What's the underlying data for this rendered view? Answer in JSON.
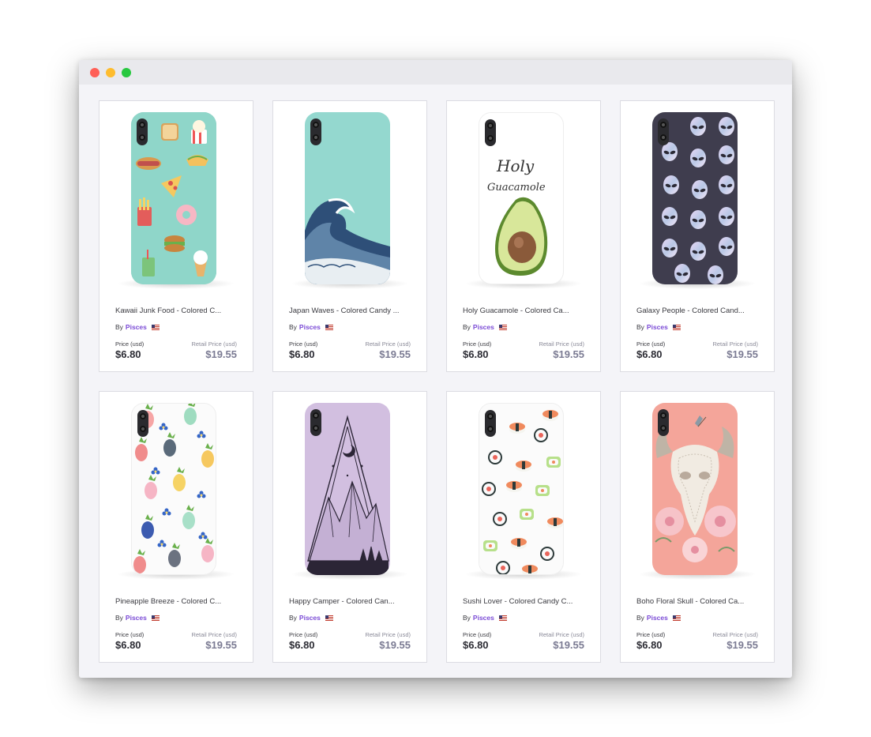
{
  "window": {
    "controls": [
      "close",
      "minimize",
      "maximize"
    ]
  },
  "labels": {
    "by": "By",
    "price": "Price (usd)",
    "retail": "Retail Price (usd)"
  },
  "products": [
    {
      "title": "Kawaii Junk Food - Colored C...",
      "seller": "Pisces",
      "price": "$6.80",
      "retail": "$19.55",
      "case_color": "#8fd6c9",
      "design": "kawaii-food-pattern"
    },
    {
      "title": "Japan Waves - Colored Candy ...",
      "seller": "Pisces",
      "price": "$6.80",
      "retail": "$19.55",
      "case_color": "#94d8cf",
      "design": "great-wave"
    },
    {
      "title": "Holy Guacamole - Colored Ca...",
      "seller": "Pisces",
      "price": "$6.80",
      "retail": "$19.55",
      "case_color": "#ffffff",
      "design": "avocado",
      "case_text_1": "Holy",
      "case_text_2": "Guacamole"
    },
    {
      "title": "Galaxy People - Colored Cand...",
      "seller": "Pisces",
      "price": "$6.80",
      "retail": "$19.55",
      "case_color": "#3f3d4e",
      "design": "alien-heads"
    },
    {
      "title": "Pineapple Breeze - Colored C...",
      "seller": "Pisces",
      "price": "$6.80",
      "retail": "$19.55",
      "case_color": "#ffffff",
      "design": "pineapples"
    },
    {
      "title": "Happy Camper - Colored Can...",
      "seller": "Pisces",
      "price": "$6.80",
      "retail": "$19.55",
      "case_color": "#d2bfe0",
      "design": "mountain-triangle"
    },
    {
      "title": "Sushi Lover - Colored Candy C...",
      "seller": "Pisces",
      "price": "$6.80",
      "retail": "$19.55",
      "case_color": "#ffffff",
      "design": "sushi-pattern"
    },
    {
      "title": "Boho Floral Skull - Colored Ca...",
      "seller": "Pisces",
      "price": "$6.80",
      "retail": "$19.55",
      "case_color": "#f4a59a",
      "design": "floral-skull"
    }
  ]
}
